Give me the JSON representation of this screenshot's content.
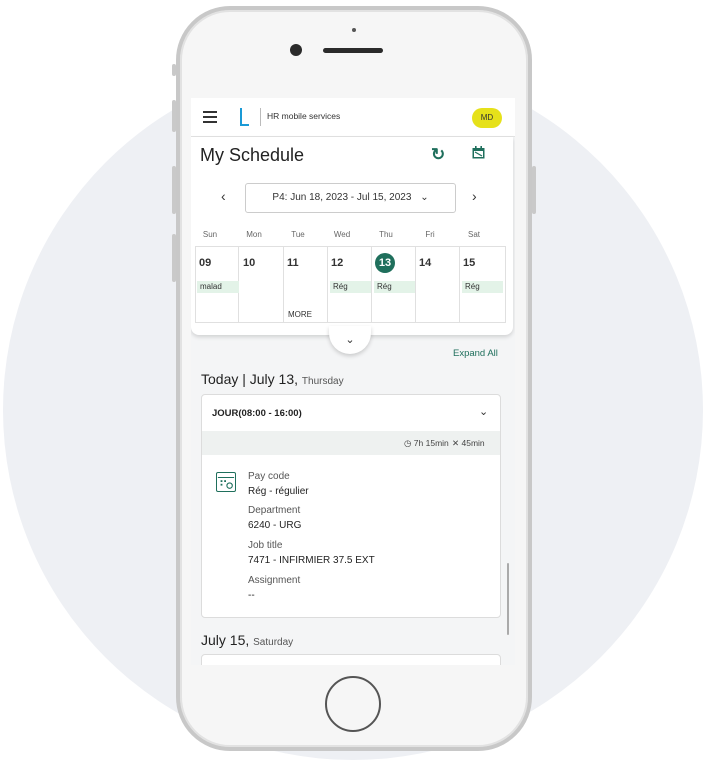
{
  "header": {
    "app_title": "HR mobile services",
    "avatar_initials": "MD",
    "avatar_color": "#e6e11a"
  },
  "schedule": {
    "title": "My Schedule",
    "period_label": "P4: Jun 18, 2023 - Jul 15, 2023",
    "prev_arrow": "‹",
    "next_arrow": "›",
    "chevron": "⌄",
    "day_names": [
      "Sun",
      "Mon",
      "Tue",
      "Wed",
      "Thu",
      "Fri",
      "Sat"
    ],
    "days": [
      {
        "num": "09",
        "tag": "malad"
      },
      {
        "num": "10",
        "tag": ""
      },
      {
        "num": "11",
        "tag": ""
      },
      {
        "num": "12",
        "tag": "Rég"
      },
      {
        "num": "13",
        "tag": "Rég"
      },
      {
        "num": "14",
        "tag": ""
      },
      {
        "num": "15",
        "tag": "Rég"
      }
    ],
    "more_label": "MORE",
    "expand_all": "Expand All"
  },
  "today": {
    "heading": "Today | July 13,",
    "weekday": "Thursday",
    "shift_title": "JOUR(08:00 - 16:00)",
    "duration": "7h 15min",
    "break": "45min",
    "details": {
      "pay_code_label": "Pay code",
      "pay_code_value": "Rég - régulier",
      "department_label": "Department",
      "department_value": "6240 - URG",
      "job_title_label": "Job title",
      "job_title_value": "7471 - INFIRMIER 37.5 EXT",
      "assignment_label": "Assignment",
      "assignment_value": "--"
    }
  },
  "next_day": {
    "heading": "July 15,",
    "weekday": "Saturday"
  },
  "colors": {
    "accent": "#1f6f5c",
    "logo": "#1a9ad6",
    "shift_tag": "#e3f3e8"
  }
}
